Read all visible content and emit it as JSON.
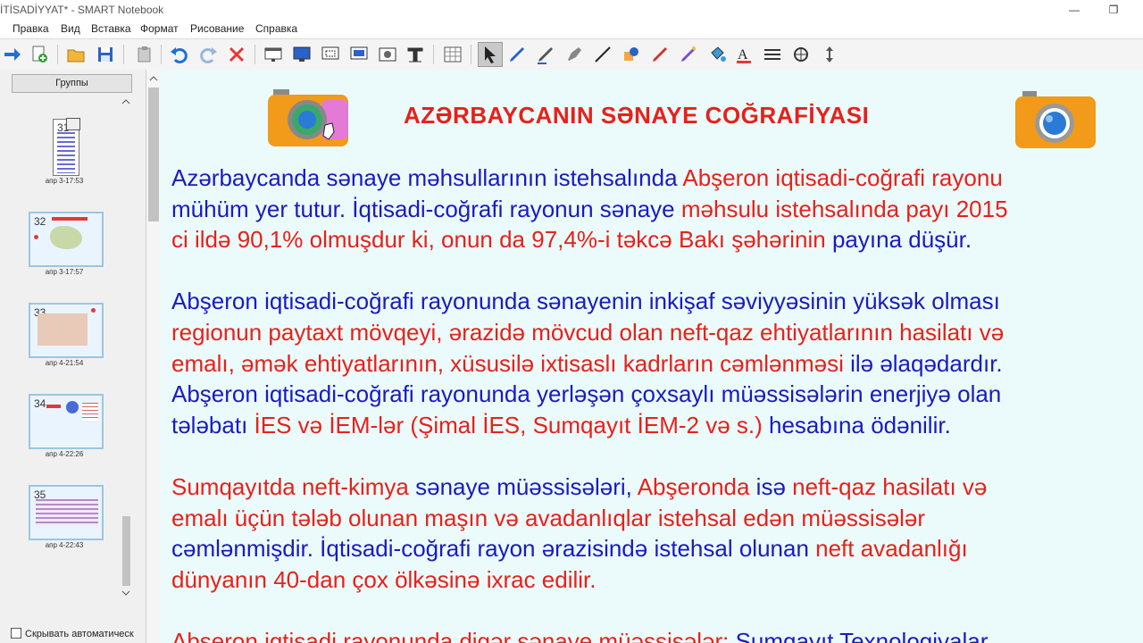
{
  "window": {
    "title": "İTİSADİYYAT* - SMART Notebook",
    "minimize": "—",
    "restore": "❐"
  },
  "menu": [
    "Правка",
    "Вид",
    "Вставка",
    "Формат",
    "Рисование",
    "Справка"
  ],
  "toolbar_icons": [
    "next-page-icon",
    "add-page-icon",
    "open-file-icon",
    "save-icon",
    "paste-icon",
    "undo-icon",
    "redo-icon",
    "delete-icon",
    "screen-shade-icon",
    "display-icon",
    "capture-icon",
    "screen-capture-icon",
    "document-camera-icon",
    "table-tool-icon",
    "table-icon",
    "select-icon",
    "pen-icon",
    "creative-pen-icon",
    "highlighter-icon",
    "eraser-icon",
    "line-icon",
    "shapes-icon",
    "magic-pen-icon",
    "shape-recognition-pen-icon",
    "fill-icon",
    "text-icon",
    "properties-icon",
    "measure-icon",
    "move-toolbar-icon"
  ],
  "sidebar": {
    "groups_button": "Группы",
    "thumbnails": [
      {
        "num": "31",
        "time": "апр 3-17:53"
      },
      {
        "num": "32",
        "time": "апр 3-17:57"
      },
      {
        "num": "33",
        "time": "апр 4-21:54"
      },
      {
        "num": "34",
        "time": "апр 4-22:26"
      },
      {
        "num": "35",
        "time": "апр 4-22:43"
      }
    ],
    "hide_auto": "Скрывать автоматическ"
  },
  "slide": {
    "title": "AZƏRBAYCANIN SƏNAYE COĞRAFİYASI",
    "lines": [
      [
        {
          "t": " Azərbaycanda sənaye məhsullarının istehsalında ",
          "c": "b"
        },
        {
          "t": "Abşeron iqtisadi-coğrafi rayonu",
          "c": "r"
        }
      ],
      [
        {
          "t": "mühüm yer tutur. İqtisadi-coğrafi rayonun sənaye ",
          "c": "b"
        },
        {
          "t": "məhsulu istehsalında payı 2015",
          "c": "r"
        }
      ],
      [
        {
          "t": "ci ildə 90,1% olmuşdur ki, onun da 97,4%-i təkcə Bakı şəhərinin ",
          "c": "r"
        },
        {
          "t": "payına düşür.",
          "c": "b"
        }
      ],
      [],
      [
        {
          "t": "Abşeron iqtisadi-coğrafi rayonunda sənayenin inkişaf səviyyəsinin yüksək olması",
          "c": "b"
        }
      ],
      [
        {
          "t": "regionun paytaxt mövqeyi, ərazidə mövcud olan neft-qaz ehtiyatlarının hasilatı və",
          "c": "r"
        }
      ],
      [
        {
          "t": "emalı, əmək ehtiyatlarının, xüsusilə ixtisaslı kadrların cəmlənməsi ",
          "c": "r"
        },
        {
          "t": "ilə əlaqədardır.",
          "c": "b"
        }
      ],
      [
        {
          "t": "Abşeron iqtisadi-coğrafi rayonunda yerləşən çoxsaylı müəssisələrin enerjiyə olan",
          "c": "b"
        }
      ],
      [
        {
          "t": "tələbatı ",
          "c": "b"
        },
        {
          "t": "İES və İEM-lər (Şimal İES, Sumqayıt İEM-2 və s.) ",
          "c": "r"
        },
        {
          "t": "hesabına ödənilir.",
          "c": "b"
        }
      ],
      [],
      [
        {
          "t": "Sumqayıtda neft-kimya ",
          "c": "r"
        },
        {
          "t": "sənaye müəssisələri, ",
          "c": "b"
        },
        {
          "t": "Abşeronda ",
          "c": "r"
        },
        {
          "t": "isə ",
          "c": "b"
        },
        {
          "t": "neft-qaz hasilatı və",
          "c": "r"
        }
      ],
      [
        {
          "t": "emalı üçün tələb olunan maşın və avadanlıqlar istehsal edən müəssisələr",
          "c": "r"
        }
      ],
      [
        {
          "t": "cəmlənmişdir. İqtisadi-coğrafi rayon ərazisində istehsal olunan ",
          "c": "b"
        },
        {
          "t": "neft avadanlığı",
          "c": "r"
        }
      ],
      [
        {
          "t": "dünyanın 40-dan çox ölkəsinə ixrac edilir.",
          "c": "r"
        }
      ],
      [],
      [
        {
          "t": "Abşeron iqtisadi rayonunda digər sənaye müəssisələr: ",
          "c": "r"
        },
        {
          "t": "Sumqayıt Texnologiyalar",
          "c": "b"
        }
      ]
    ]
  }
}
